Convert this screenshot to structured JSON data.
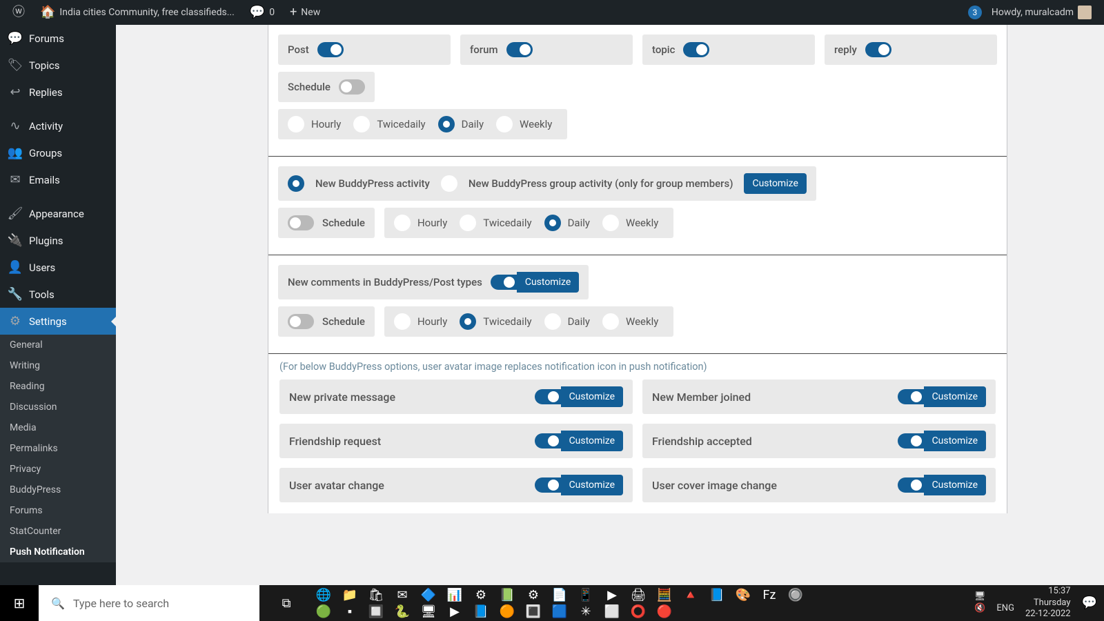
{
  "wpbar": {
    "site_title": "India cities Community, free classifieds...",
    "comment_count": "0",
    "new_label": "New",
    "updates_count": "3",
    "howdy": "Howdy, muralcadm"
  },
  "sidebar": {
    "items": [
      {
        "icon": "💬",
        "label": "Forums",
        "name": "forums"
      },
      {
        "icon": "🏷",
        "label": "Topics",
        "name": "topics"
      },
      {
        "icon": "↩",
        "label": "Replies",
        "name": "replies"
      },
      {
        "icon": "∿",
        "label": "Activity",
        "name": "activity",
        "sep": true
      },
      {
        "icon": "👥",
        "label": "Groups",
        "name": "groups"
      },
      {
        "icon": "✉",
        "label": "Emails",
        "name": "emails"
      },
      {
        "icon": "🖌",
        "label": "Appearance",
        "name": "appearance",
        "sep": true
      },
      {
        "icon": "🔌",
        "label": "Plugins",
        "name": "plugins"
      },
      {
        "icon": "👤",
        "label": "Users",
        "name": "users"
      },
      {
        "icon": "🔧",
        "label": "Tools",
        "name": "tools"
      },
      {
        "icon": "⚙",
        "label": "Settings",
        "name": "settings",
        "active": true
      }
    ],
    "sub_items": [
      {
        "label": "General"
      },
      {
        "label": "Writing"
      },
      {
        "label": "Reading"
      },
      {
        "label": "Discussion"
      },
      {
        "label": "Media"
      },
      {
        "label": "Permalinks"
      },
      {
        "label": "Privacy"
      },
      {
        "label": "BuddyPress"
      },
      {
        "label": "Forums"
      },
      {
        "label": "StatCounter"
      },
      {
        "label": "Push Notification",
        "current": true
      }
    ]
  },
  "section1": {
    "toggles": [
      {
        "label": "Post",
        "on": true,
        "name": "post"
      },
      {
        "label": "forum",
        "on": true,
        "name": "forum"
      },
      {
        "label": "topic",
        "on": true,
        "name": "topic"
      },
      {
        "label": "reply",
        "on": true,
        "name": "reply"
      }
    ],
    "schedule": {
      "label": "Schedule",
      "on": false
    },
    "freq": {
      "options": [
        "Hourly",
        "Twicedaily",
        "Daily",
        "Weekly"
      ],
      "selected_index": 2
    }
  },
  "section2": {
    "opts": {
      "opt1": {
        "label": "New BuddyPress activity",
        "selected": true
      },
      "opt2": {
        "label": "New BuddyPress group activity (only for group members)",
        "selected": false
      }
    },
    "customize": "Customize",
    "schedule": {
      "label": "Schedule",
      "on": false
    },
    "freq": {
      "options": [
        "Hourly",
        "Twicedaily",
        "Daily",
        "Weekly"
      ],
      "selected_index": 2
    }
  },
  "section3": {
    "label": "New comments in BuddyPress/Post types",
    "on": true,
    "customize": "Customize",
    "schedule": {
      "label": "Schedule",
      "on": false
    },
    "freq": {
      "options": [
        "Hourly",
        "Twicedaily",
        "Daily",
        "Weekly"
      ],
      "selected_index": 1
    }
  },
  "section4": {
    "note": "(For below BuddyPress options, user avatar image replaces notification icon in push notification)",
    "customize": "Customize",
    "cards": [
      {
        "label": "New private message",
        "on": true
      },
      {
        "label": "New Member joined",
        "on": true
      },
      {
        "label": "Friendship request",
        "on": true
      },
      {
        "label": "Friendship accepted",
        "on": true
      },
      {
        "label": "User avatar change",
        "on": true
      },
      {
        "label": "User cover image change",
        "on": true
      }
    ]
  },
  "taskbar": {
    "search_placeholder": "Type here to search",
    "lang": "ENG",
    "time": "15:37",
    "day": "Thursday",
    "date": "22-12-2022"
  }
}
